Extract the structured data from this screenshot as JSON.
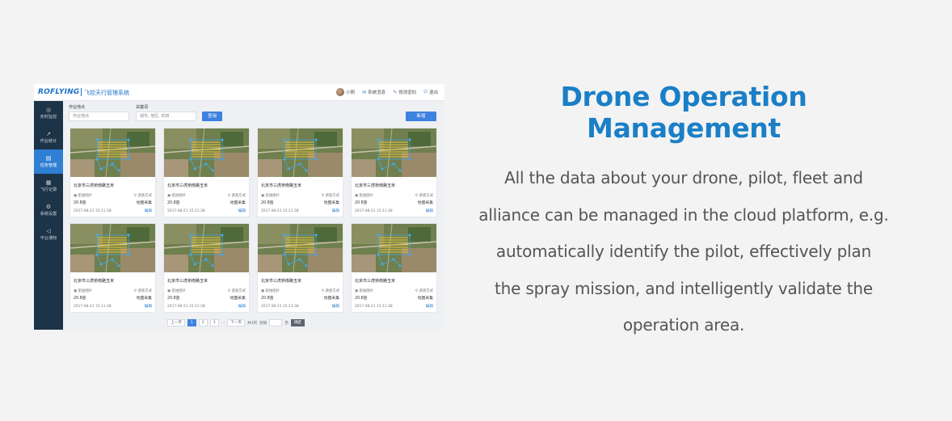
{
  "app": {
    "logo": "ROFLYING",
    "system_name": "飞控天行管理系统",
    "header": {
      "user": "小刚",
      "messages": "系统消息",
      "change_password": "修改密码",
      "logout": "退出"
    },
    "sidebar": [
      {
        "label": "实时监控",
        "icon": "monitor-icon"
      },
      {
        "label": "作业统计",
        "icon": "chart-icon"
      },
      {
        "label": "任务管理",
        "icon": "task-icon",
        "active": true
      },
      {
        "label": "飞行记录",
        "icon": "record-icon"
      },
      {
        "label": "系统设置",
        "icon": "gear-icon"
      },
      {
        "label": "平台通知",
        "icon": "speaker-icon"
      }
    ],
    "filters": {
      "location_label": "作业地点",
      "location_placeholder": "作业地点",
      "keyword_label": "关键词",
      "keyword_placeholder": "城市, 地区, 农田",
      "search_button": "查询",
      "add_button": "新增"
    },
    "cards": [
      {
        "title": "北京市三虎桥南路玉米",
        "tag": "航拍图片",
        "area": "20.8亩",
        "status": "调查方式",
        "status2": "地图采集",
        "date": "2017-08-21 15:11:38",
        "action": "编辑"
      },
      {
        "title": "北京市三虎桥南路玉米",
        "tag": "航拍图片",
        "area": "20.8亩",
        "status": "调查方式",
        "status2": "地图采集",
        "date": "2017-08-21 15:11:38",
        "action": "编辑"
      },
      {
        "title": "北京市三虎桥南路玉米",
        "tag": "航拍图片",
        "area": "20.8亩",
        "status": "调查方式",
        "status2": "地图采集",
        "date": "2017-08-21 15:11:38",
        "action": "编辑"
      },
      {
        "title": "北京市三虎桥南路玉米",
        "tag": "航拍图片",
        "area": "20.8亩",
        "status": "调查方式",
        "status2": "地图采集",
        "date": "2017-08-21 15:11:38",
        "action": "编辑"
      },
      {
        "title": "北京市三虎桥南路玉米",
        "tag": "航拍图片",
        "area": "20.8亩",
        "status": "调查方式",
        "status2": "地图采集",
        "date": "2017-08-21 15:11:38",
        "action": "编辑"
      },
      {
        "title": "北京市三虎桥南路玉米",
        "tag": "航拍图片",
        "area": "20.8亩",
        "status": "调查方式",
        "status2": "地图采集",
        "date": "2017-08-21 15:11:38",
        "action": "编辑"
      },
      {
        "title": "北京市三虎桥南路玉米",
        "tag": "航拍图片",
        "area": "20.8亩",
        "status": "调查方式",
        "status2": "地图采集",
        "date": "2017-08-21 15:11:38",
        "action": "编辑"
      },
      {
        "title": "北京市三虎桥南路玉米",
        "tag": "航拍图片",
        "area": "20.8亩",
        "status": "调查方式",
        "status2": "地图采集",
        "date": "2017-08-21 15:11:38",
        "action": "编辑"
      }
    ],
    "pagination": {
      "prev": "上一页",
      "pages": [
        "1",
        "2",
        "3"
      ],
      "ellipsis": "…",
      "next": "下一页",
      "total": "共3页",
      "goto_label": "到第",
      "page_unit": "页",
      "confirm": "确定"
    }
  },
  "headline": "Drone Operation Management",
  "description_lines": [
    "All the data about your drone, pilot, fleet and",
    "alliance can be managed in the cloud platform, e.g.",
    "automatically identify the pilot, effectively plan",
    "the spray mission, and intelligently validate the",
    "operation area."
  ],
  "colors": {
    "accent": "#1a7fc6",
    "sidebar": "#1d3448",
    "active": "#2f7fd4",
    "body_text": "#555555"
  }
}
